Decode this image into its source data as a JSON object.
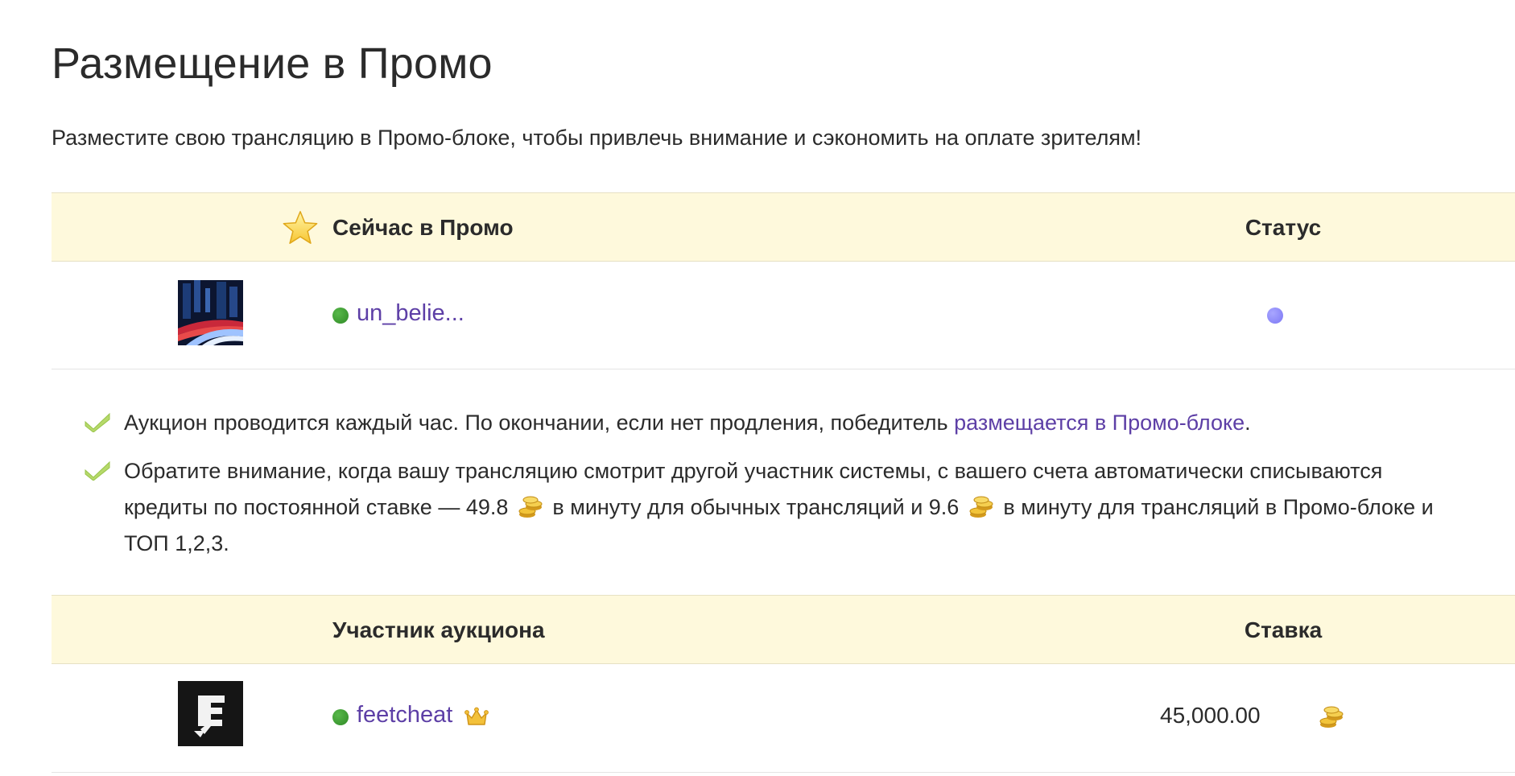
{
  "page": {
    "title": "Размещение в Промо",
    "intro": "Разместите свою трансляцию в Промо-блоке, чтобы привлечь внимание и сэкономить на оплате зрителям!"
  },
  "promo_table": {
    "header_title": "Сейчас в Промо",
    "header_status": "Статус",
    "header_icon": "star-icon",
    "row": {
      "username": "un_belie...",
      "online": true,
      "status_color": "#8c88fb"
    }
  },
  "notes": {
    "item1": {
      "text_before": "Аукцион проводится каждый час. По окончании, если нет продления, победитель ",
      "link": "размещается в Промо-блоке",
      "text_after": "."
    },
    "item2": {
      "part1": "Обратите внимание, когда вашу трансляцию смотрит другой участник системы, с вашего счета автоматически списываются кредиты по постоянной ставке — 49.8",
      "part2": "в минуту для обычных трансляций и 9.6",
      "part3": "в минуту для трансляций в Промо-блоке и ТОП 1,2,3."
    }
  },
  "auction_table": {
    "header_participant": "Участник аукциона",
    "header_bid": "Ставка",
    "row": {
      "username": "feetcheat",
      "online": true,
      "badge_icon": "crown-icon",
      "bid": "45,000.00",
      "currency_icon": "coin-icon"
    }
  },
  "colors": {
    "header_bg": "#fef9dc",
    "link": "#5d3fa6",
    "online": "#3e9b33",
    "check": "#b5d86a"
  }
}
